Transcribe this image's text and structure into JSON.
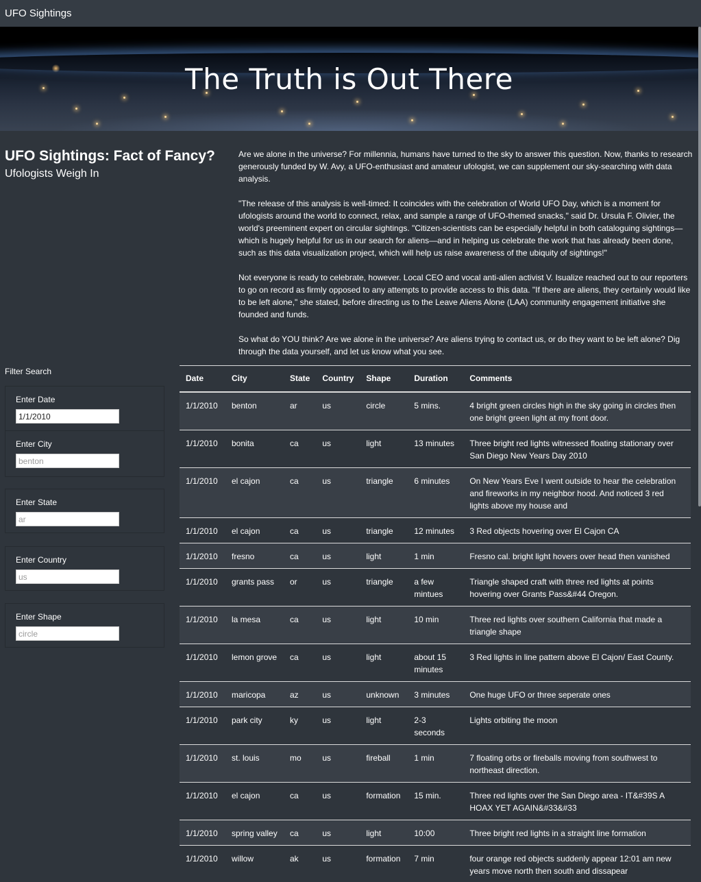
{
  "navbar": {
    "brand": "UFO Sightings"
  },
  "hero": {
    "title": "The Truth is Out There"
  },
  "side": {
    "title": "UFO Sightings: Fact of Fancy?",
    "subtitle": "Ufologists Weigh In"
  },
  "article": {
    "paragraphs": [
      "Are we alone in the universe? For millennia, humans have turned to the sky to answer this question. Now, thanks to research generously funded by W. Avy, a UFO-enthusiast and amateur ufologist, we can supplement our sky-searching with data analysis.",
      "\"The release of this analysis is well-timed: It coincides with the celebration of World UFO Day, which is a moment for ufologists around the world to connect, relax, and sample a range of UFO-themed snacks,\" said Dr. Ursula F. Olivier, the world's preeminent expert on circular sightings. \"Citizen-scientists can be especially helpful in both cataloguing sightings—which is hugely helpful for us in our search for aliens—and in helping us celebrate the work that has already been done, such as this data visualization project, which will help us raise awareness of the ubiquity of sightings!\"",
      "Not everyone is ready to celebrate, however. Local CEO and vocal anti-alien activist V. Isualize reached out to our reporters to go on record as firmly opposed to any attempts to provide access to this data. \"If there are aliens, they certainly would like to be left alone,\" she stated, before directing us to the Leave Aliens Alone (LAA) community engagement initiative she founded and funds.",
      "So what do YOU think? Are we alone in the universe? Are aliens trying to contact us, or do they want to be left alone? Dig through the data yourself, and let us know what you see."
    ]
  },
  "filters": {
    "title": "Filter Search",
    "date": {
      "label": "Enter Date",
      "value": "1/1/2010",
      "placeholder": "1/1/2010"
    },
    "city": {
      "label": "Enter City",
      "placeholder": "benton"
    },
    "state": {
      "label": "Enter State",
      "placeholder": "ar"
    },
    "country": {
      "label": "Enter Country",
      "placeholder": "us"
    },
    "shape": {
      "label": "Enter Shape",
      "placeholder": "circle"
    }
  },
  "table": {
    "headers": [
      "Date",
      "City",
      "State",
      "Country",
      "Shape",
      "Duration",
      "Comments"
    ],
    "rows": [
      [
        "1/1/2010",
        "benton",
        "ar",
        "us",
        "circle",
        "5 mins.",
        "4 bright green circles high in the sky going in circles then one bright green light at my front door."
      ],
      [
        "1/1/2010",
        "bonita",
        "ca",
        "us",
        "light",
        "13 minutes",
        "Three bright red lights witnessed floating stationary over San Diego New Years Day 2010"
      ],
      [
        "1/1/2010",
        "el cajon",
        "ca",
        "us",
        "triangle",
        "6 minutes",
        "On New Years Eve I went outside to hear the celebration and fireworks in my neighbor hood. And noticed 3 red lights above my house and"
      ],
      [
        "1/1/2010",
        "el cajon",
        "ca",
        "us",
        "triangle",
        "12 minutes",
        "3 Red objects hovering over El Cajon CA"
      ],
      [
        "1/1/2010",
        "fresno",
        "ca",
        "us",
        "light",
        "1 min",
        "Fresno cal. bright light hovers over head then vanished"
      ],
      [
        "1/1/2010",
        "grants pass",
        "or",
        "us",
        "triangle",
        "a few mintues",
        "Triangle shaped craft with three red lights at points hovering over Grants Pass&#44 Oregon."
      ],
      [
        "1/1/2010",
        "la mesa",
        "ca",
        "us",
        "light",
        "10 min",
        "Three red lights over southern California that made a triangle shape"
      ],
      [
        "1/1/2010",
        "lemon grove",
        "ca",
        "us",
        "light",
        "about 15 minutes",
        "3 Red lights in line pattern above El Cajon/ East County."
      ],
      [
        "1/1/2010",
        "maricopa",
        "az",
        "us",
        "unknown",
        "3 minutes",
        "One huge UFO or three seperate ones"
      ],
      [
        "1/1/2010",
        "park city",
        "ky",
        "us",
        "light",
        "2-3 seconds",
        "Lights orbiting the moon"
      ],
      [
        "1/1/2010",
        "st. louis",
        "mo",
        "us",
        "fireball",
        "1 min",
        "7 floating orbs or fireballs moving from southwest to northeast direction."
      ],
      [
        "1/1/2010",
        "el cajon",
        "ca",
        "us",
        "formation",
        "15 min.",
        "Three red lights over the San Diego area - IT&#39S A HOAX YET AGAIN&#33&#33"
      ],
      [
        "1/1/2010",
        "spring valley",
        "ca",
        "us",
        "light",
        "10:00",
        "Three bright red lights in a straight line formation"
      ],
      [
        "1/1/2010",
        "willow",
        "ak",
        "us",
        "formation",
        "7 min",
        "four orange red objects suddenly appear 12:01 am new years move north then south and dissapear"
      ]
    ]
  }
}
